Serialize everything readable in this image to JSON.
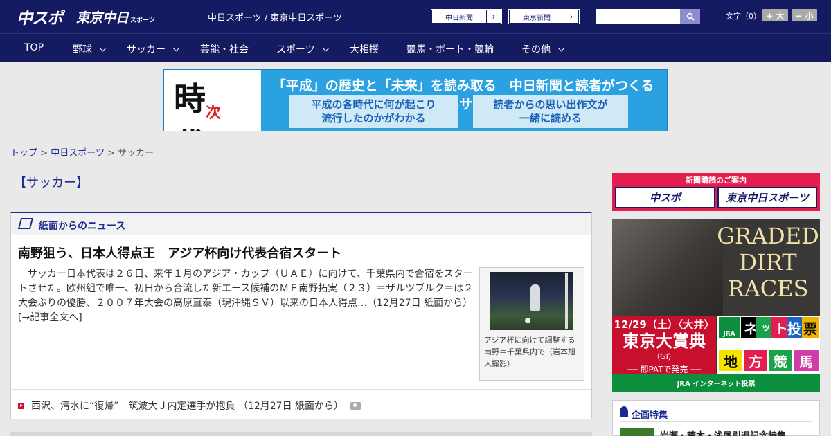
{
  "header": {
    "logo_chuspo": "中スポ",
    "logo_tokyo": "東京中日",
    "logo_tokyo_small": "スポーツ",
    "site_links": "中日スポーツ / 東京中日スポーツ",
    "newspaper_buttons": [
      {
        "label": "中日新聞"
      },
      {
        "label": "東京新聞"
      }
    ],
    "search": {
      "placeholder": "",
      "value": ""
    },
    "font_label": "文字（0）",
    "font_plus": "+ 大",
    "font_minus": "− 小"
  },
  "nav": {
    "items": [
      {
        "label": "TOP",
        "has_menu": false
      },
      {
        "label": "野球",
        "has_menu": true
      },
      {
        "label": "サッカー",
        "has_menu": true
      },
      {
        "label": "芸能・社会",
        "has_menu": false
      },
      {
        "label": "スポーツ",
        "has_menu": true
      },
      {
        "label": "大相撲",
        "has_menu": false
      },
      {
        "label": "競馬・ボート・競輪",
        "has_menu": false
      },
      {
        "label": "その他",
        "has_menu": true
      }
    ]
  },
  "banner": {
    "ji_main": "時代",
    "ji_sub": "次",
    "headline": "「平成」の歴史と「未来」を読み取る　中日新聞と読者がつくるWebサイト",
    "box1_line1": "平成の各時代に何が起こり",
    "box1_line2": "流行したのかがわかる",
    "box2_line1": "読者からの思い出作文が",
    "box2_line2": "一緒に読める"
  },
  "breadcrumb": {
    "items": [
      "トップ",
      "中日スポーツ",
      "サッカー"
    ],
    "separator": ">"
  },
  "main": {
    "category_title": "【サッカー】",
    "news_heading": "紙面からのニュース",
    "article": {
      "title": "南野狙う、日本人得点王　アジア杯向け代表合宿スタート",
      "body": "　サッカー日本代表は２６日、来年１月のアジア・カップ（ＵＡＥ）に向けて、千葉県内で合宿をスタートさせた。欧州組で唯一、初日から合流した新エース候補のＭＦ南野拓実（２３）＝ザルツブルク＝は２大会ぶりの優勝、２００７年大会の高原直泰（現沖縄ＳＶ）以来の日本人得点…（12月27日 紙面から）　[→記事全文へ]",
      "photo_caption": "アジア杯に向けて調整する南野＝千葉県内で（岩本旭人撮影）"
    },
    "sub_items": [
      {
        "text": "西沢、清水に“復帰”　筑波大Ｊ内定選手が抱負 （12月27日 紙面から）"
      }
    ]
  },
  "sidebar": {
    "subscribe": {
      "caption": "新聞購読のご案内",
      "btn1": "中スポ",
      "btn2": "東京中日スポーツ"
    },
    "jra_ad": {
      "graded": "GRADED DIRT RACES",
      "date": "12/29（土）〈大井〉",
      "race": "東京大賞典",
      "grade": "（GI）",
      "pat": "── 即PATで発売 ──",
      "tiles_top": [
        "ネ",
        "ッ",
        "ト",
        "投",
        "票"
      ],
      "tiles_bottom": [
        "地",
        "方",
        "競",
        "馬"
      ],
      "jra_label": "JRA",
      "footer": "JRA インターネット投票"
    },
    "kikaku": {
      "title": "企画特集",
      "item": "岩瀬・荒木・浅尾引退記念特集"
    }
  },
  "colors": {
    "header_bg": "#141b63",
    "link": "#1a2a90",
    "accent_red": "#d0102a"
  }
}
